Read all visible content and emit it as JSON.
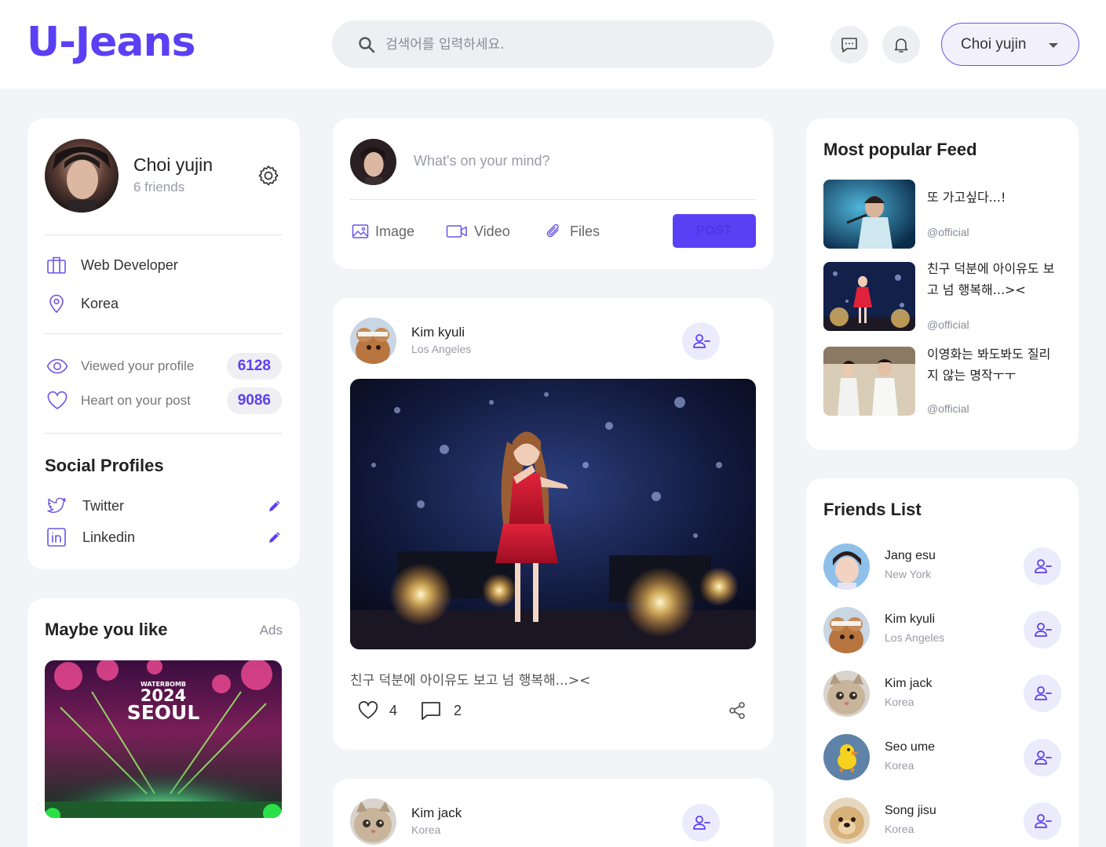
{
  "header": {
    "logo": "U-Jeans",
    "search_placeholder": "검색어를 입력하세요.",
    "user_name": "Choi yujin"
  },
  "profile": {
    "name": "Choi yujin",
    "friends": "6 friends",
    "job": "Web Developer",
    "location": "Korea",
    "stats": [
      {
        "label": "Viewed your profile",
        "value": "6128"
      },
      {
        "label": "Heart on your post",
        "value": "9086"
      }
    ],
    "social_title": "Social Profiles",
    "social": [
      {
        "label": "Twitter"
      },
      {
        "label": "Linkedin"
      }
    ]
  },
  "ads": {
    "title": "Maybe you like",
    "tag": "Ads",
    "banner_top": "WATERBOMB",
    "banner_year": "2024",
    "banner_city": "SEOUL"
  },
  "composer": {
    "placeholder": "What's on your mind?",
    "image_label": "Image",
    "video_label": "Video",
    "files_label": "Files",
    "post_label": "POST"
  },
  "posts": [
    {
      "author": "Kim kyuli",
      "location": "Los Angeles",
      "caption": "친구 덕분에 아이유도 보고 넘 행복해...><",
      "likes": "4",
      "comments": "2"
    },
    {
      "author": "Kim jack",
      "location": "Korea"
    }
  ],
  "popular": {
    "title": "Most popular Feed",
    "items": [
      {
        "title": "또 가고싶다...!",
        "by": "@official"
      },
      {
        "title": "친구 덕분에 아이유도 보고 넘 행복해...><",
        "by": "@official"
      },
      {
        "title": "이영화는 봐도봐도 질리지 않는 명작ㅜㅜ",
        "by": "@official"
      }
    ]
  },
  "friends": {
    "title": "Friends List",
    "items": [
      {
        "name": "Jang esu",
        "location": "New York"
      },
      {
        "name": "Kim kyuli",
        "location": "Los Angeles"
      },
      {
        "name": "Kim jack",
        "location": "Korea"
      },
      {
        "name": "Seo ume",
        "location": "Korea"
      },
      {
        "name": "Song jisu",
        "location": "Korea"
      }
    ]
  },
  "colors": {
    "accent": "#5b3ff5",
    "background": "#f3f4f8",
    "card": "#ffffff"
  }
}
